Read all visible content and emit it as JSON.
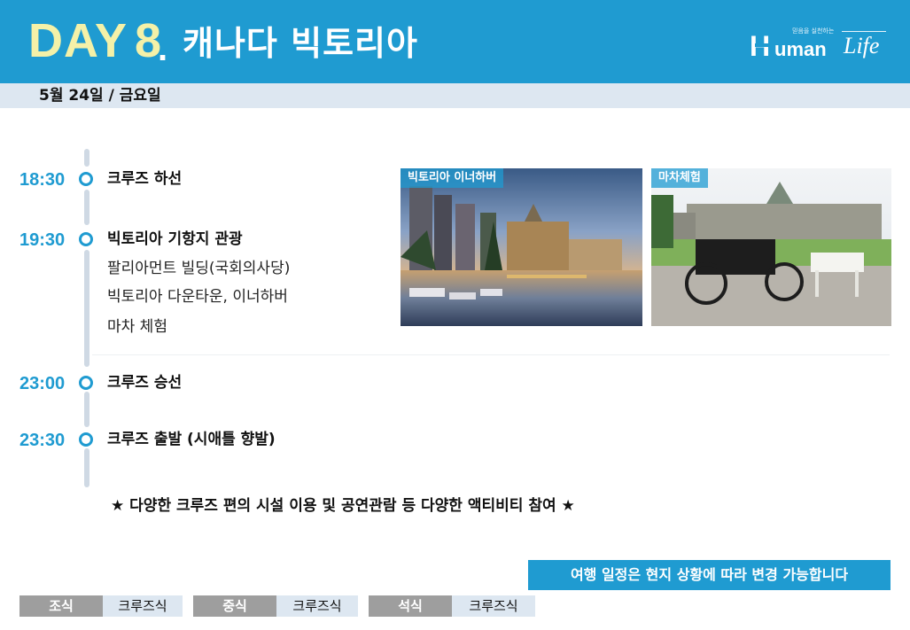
{
  "header": {
    "day_word": "DAY",
    "day_number": "8",
    "day_dot": ".",
    "city": "캐나다 빅토리아",
    "logo": {
      "tagline": "믿음을 실천하는",
      "letter_h": "H",
      "word_uman": "uman",
      "word_life": "Life"
    }
  },
  "date": "5월 24일 / 금요일",
  "schedule": [
    {
      "time": "18:30",
      "title": "크루즈 하선",
      "details": []
    },
    {
      "time": "19:30",
      "title": "빅토리아 기항지 관광",
      "details": [
        "팔리아먼트 빌딩(국회의사당)",
        "빅토리아 다운타운, 이너하버",
        "마차 체험"
      ]
    },
    {
      "time": "23:00",
      "title": "크루즈 승선",
      "details": []
    },
    {
      "time": "23:30",
      "title": "크루즈 출발 (시애틀 향발)",
      "details": []
    }
  ],
  "photos": [
    {
      "label": "빅토리아 이너하버"
    },
    {
      "label": "마차체험"
    }
  ],
  "notice": "★ 다양한 크루즈 편의 시설 이용 및 공연관람 등 다양한 액티비티 참여 ★",
  "change_note": "여행 일정은 현지 상황에 따라 변경 가능합니다",
  "meals": [
    {
      "label": "조식",
      "value": "크루즈식"
    },
    {
      "label": "중식",
      "value": "크루즈식"
    },
    {
      "label": "석식",
      "value": "크루즈식"
    }
  ],
  "colors": {
    "accent": "#1f9bd1",
    "day_text": "#f4f1a8",
    "band": "#dde7f1",
    "meal_label": "#9e9e9e"
  }
}
